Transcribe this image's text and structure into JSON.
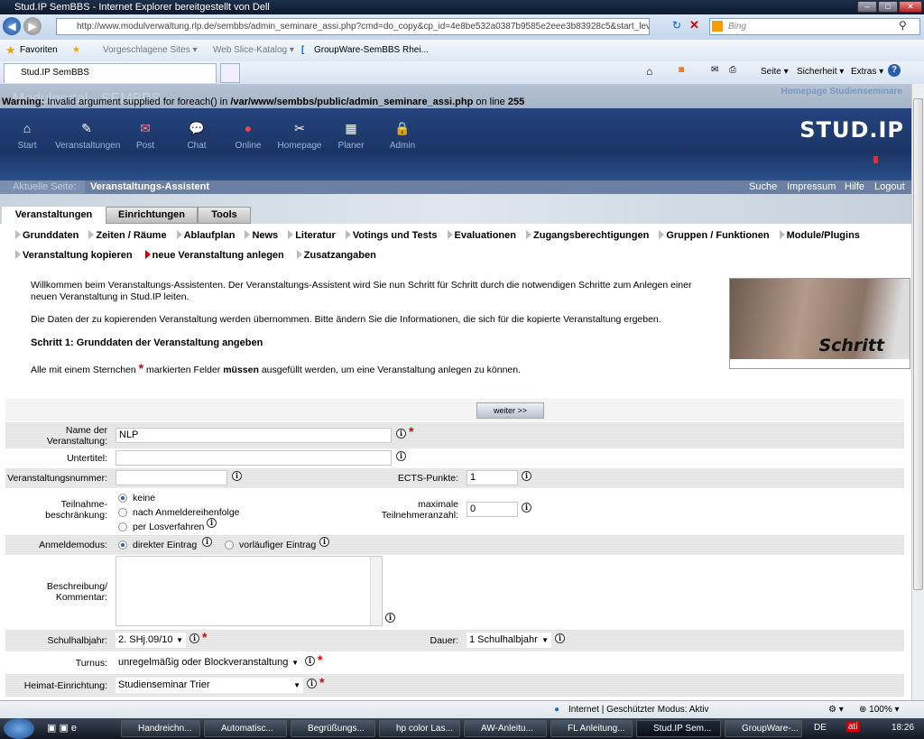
{
  "window": {
    "title": "Stud.IP SemBBS - Internet Explorer bereitgestellt von Dell"
  },
  "browser": {
    "url": "http://www.modulverwaltung.rlp.de/sembbs/admin_seminare_assi.php?cmd=do_copy&cp_id=4e8be532a0387b9585e2eee3b83928c5&start_level=",
    "search_placeholder": "Bing",
    "favorites_label": "Favoriten",
    "fav_links": [
      "Vorgeschlagene Sites ▾",
      "Web Slice-Katalog ▾",
      "GroupWare-SemBBS Rhei..."
    ],
    "tab_title": "Stud.IP SemBBS",
    "tools": [
      "Seite ▾",
      "Sicherheit ▾",
      "Extras ▾"
    ]
  },
  "page": {
    "top_link": "Homepage Studienseminare",
    "warning_prefix": "Warning:",
    "warning_text": " Invalid argument supplied for foreach() in ",
    "warning_path": "/var/www/sembbs/public/admin_seminare_assi.php",
    "warning_suffix": " on line ",
    "warning_line": "255",
    "ghost_title": "Modulportal - SEMBBS",
    "logo": "STUD.IP",
    "nav": [
      {
        "label": "Start",
        "icon": "house-icon"
      },
      {
        "label": "Veranstaltungen",
        "icon": "courses-icon"
      },
      {
        "label": "Post",
        "icon": "mail-icon"
      },
      {
        "label": "Chat",
        "icon": "chat-icon"
      },
      {
        "label": "Online",
        "icon": "online-icon"
      },
      {
        "label": "Homepage",
        "icon": "tools-icon"
      },
      {
        "label": "Planer",
        "icon": "calendar-icon"
      },
      {
        "label": "Admin",
        "icon": "lock-icon"
      }
    ],
    "breadcrumb": {
      "label": "Aktuelle Seite:",
      "current": "Veranstaltungs-Assistent"
    },
    "top_links": [
      "Suche",
      "Impressum",
      "Hilfe",
      "Logout"
    ],
    "tabs": [
      "Veranstaltungen",
      "Einrichtungen",
      "Tools"
    ],
    "subnav1": [
      "Grunddaten",
      "Zeiten / Räume",
      "Ablaufplan",
      "News",
      "Literatur",
      "Votings und Tests",
      "Evaluationen",
      "Zugangsberechtigungen",
      "Gruppen / Funktionen",
      "Module/Plugins"
    ],
    "subnav2": [
      "Veranstaltung kopieren",
      "neue Veranstaltung anlegen",
      "Zusatzangaben"
    ],
    "intro1": "Willkommen beim Veranstaltungs-Assistenten. Der Veranstaltungs-Assistent wird Sie nun Schritt für Schritt durch die notwendigen Schritte zum Anlegen einer neuen Veranstaltung in Stud.IP leiten.",
    "intro2": "Die Daten der zu kopierenden Veranstaltung werden übernommen. Bitte ändern Sie die Informationen, die sich für die kopierte Veranstaltung ergeben.",
    "step_title": "Schritt 1: Grunddaten der Veranstaltung angeben",
    "req_pre": "Alle mit einem Sternchen ",
    "req_mid": " markierten Felder ",
    "req_bold": "müssen",
    "req_post": " ausgefüllt werden, um eine Veranstaltung anlegen zu können.",
    "image_caption": "Schritt"
  },
  "form": {
    "next": "weiter >>",
    "name_label": "Name der Veranstaltung:",
    "name_value": "NLP",
    "subtitle_label": "Untertitel:",
    "subtitle_value": "",
    "number_label": "Veranstaltungsnummer:",
    "number_value": "",
    "ects_label": "ECTS-Punkte:",
    "ects_value": "1",
    "limit_label": "Teilnahme-beschränkung:",
    "limit_options": [
      "keine",
      "nach Anmeldereihenfolge",
      "per Losverfahren"
    ],
    "limit_selected": "keine",
    "max_label": "maximale Teilnehmeranzahl:",
    "max_value": "0",
    "mode_label": "Anmeldemodus:",
    "mode_options": [
      "direkter Eintrag",
      "vorläufiger Eintrag"
    ],
    "mode_selected": "direkter Eintrag",
    "desc_label": "Beschreibung/ Kommentar:",
    "desc_value": "",
    "term_label": "Schulhalbjahr:",
    "term_value": "2. SHj.09/10",
    "duration_label": "Dauer:",
    "duration_value": "1 Schulhalbjahr",
    "turnus_label": "Turnus:",
    "turnus_value": "unregelmäßig oder Blockveranstaltung",
    "home_label": "Heimat-Einrichtung:",
    "home_value": "Studienseminar Trier"
  },
  "status": {
    "zone": "Internet | Geschützter Modus: Aktiv",
    "zoom": "100%"
  },
  "taskbar": {
    "items": [
      "Handreichn...",
      "Automatisc...",
      "Begrüßungs...",
      "hp color Las...",
      "AW-Anleitu...",
      "FL Anleitung...",
      "Stud.IP Sem...",
      "GroupWare-..."
    ],
    "lang": "DE",
    "time": "18:26"
  }
}
